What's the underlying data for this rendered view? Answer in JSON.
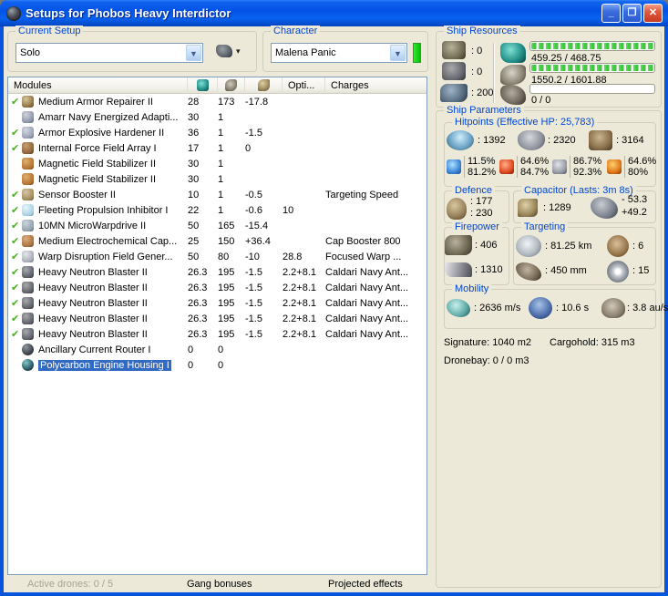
{
  "window": {
    "title": "Setups for Phobos Heavy Interdictor",
    "minimize": "_",
    "maximize": "❐",
    "close": "✕"
  },
  "colors": {
    "titlebar_blue": "#0855DD",
    "groupbox_label_blue": "#0046D5",
    "selection_blue": "#316AC5",
    "check_green": "#4CAE22",
    "resource_bar_green": "#2FC52F",
    "character_status_green": "#00D400"
  },
  "current_setup": {
    "label": "Current Setup",
    "value": "Solo",
    "ship_menu_arrow": "▾"
  },
  "character": {
    "label": "Character",
    "value": "Malena Panic"
  },
  "ship_resources": {
    "label": "Ship Resources",
    "turrets": ": 0",
    "launchers": ": 0",
    "calibration": ": 200",
    "cpu_text": "459.25 / 468.75",
    "powergrid_text": "1550.2 / 1601.88",
    "dronebandwidth_text": "0 / 0",
    "cpu_fill_pct": 100,
    "powergrid_fill_pct": 100,
    "dronebandwidth_fill_pct": 0
  },
  "modules_table": {
    "columns": {
      "modules": "Modules",
      "opti": "Opti...",
      "charges": "Charges"
    },
    "rows": [
      {
        "check": true,
        "icon": "armor-repairer",
        "name": "Medium Armor Repairer II",
        "cpu": "28",
        "pg": "173",
        "cap": "-17.8",
        "opti": "",
        "charge": ""
      },
      {
        "check": false,
        "icon": "energized-membrane",
        "name": "Amarr Navy Energized Adapti...",
        "cpu": "30",
        "pg": "1",
        "cap": "",
        "opti": "",
        "charge": ""
      },
      {
        "check": true,
        "icon": "armor-hardener",
        "name": "Armor Explosive Hardener II",
        "cpu": "36",
        "pg": "1",
        "cap": "-1.5",
        "opti": "",
        "charge": ""
      },
      {
        "check": true,
        "icon": "force-field-array",
        "name": "Internal Force Field Array I",
        "cpu": "17",
        "pg": "1",
        "cap": "0",
        "opti": "",
        "charge": ""
      },
      {
        "check": false,
        "icon": "mag-stab",
        "name": "Magnetic Field Stabilizer II",
        "cpu": "30",
        "pg": "1",
        "cap": "",
        "opti": "",
        "charge": ""
      },
      {
        "check": false,
        "icon": "mag-stab",
        "name": "Magnetic Field Stabilizer II",
        "cpu": "30",
        "pg": "1",
        "cap": "",
        "opti": "",
        "charge": ""
      },
      {
        "check": true,
        "icon": "sensor-booster",
        "name": "Sensor Booster II",
        "cpu": "10",
        "pg": "1",
        "cap": "-0.5",
        "opti": "",
        "charge": "Targeting Speed"
      },
      {
        "check": true,
        "icon": "stasis-web",
        "name": "Fleeting Propulsion Inhibitor I",
        "cpu": "22",
        "pg": "1",
        "cap": "-0.6",
        "opti": "10",
        "charge": ""
      },
      {
        "check": true,
        "icon": "mwd",
        "name": "10MN MicroWarpdrive II",
        "cpu": "50",
        "pg": "165",
        "cap": "-15.4",
        "opti": "",
        "charge": ""
      },
      {
        "check": true,
        "icon": "cap-booster",
        "name": "Medium Electrochemical Cap...",
        "cpu": "25",
        "pg": "150",
        "cap": "+36.4",
        "opti": "",
        "charge": "Cap Booster 800"
      },
      {
        "check": true,
        "icon": "warp-disruptor-field",
        "name": "Warp Disruption Field Gener...",
        "cpu": "50",
        "pg": "80",
        "cap": "-10",
        "opti": "28.8",
        "charge": "Focused Warp ..."
      },
      {
        "check": true,
        "icon": "blaster",
        "name": "Heavy Neutron Blaster II",
        "cpu": "26.3",
        "pg": "195",
        "cap": "-1.5",
        "opti": "2.2+8.1",
        "charge": "Caldari Navy Ant..."
      },
      {
        "check": true,
        "icon": "blaster",
        "name": "Heavy Neutron Blaster II",
        "cpu": "26.3",
        "pg": "195",
        "cap": "-1.5",
        "opti": "2.2+8.1",
        "charge": "Caldari Navy Ant..."
      },
      {
        "check": true,
        "icon": "blaster",
        "name": "Heavy Neutron Blaster II",
        "cpu": "26.3",
        "pg": "195",
        "cap": "-1.5",
        "opti": "2.2+8.1",
        "charge": "Caldari Navy Ant..."
      },
      {
        "check": true,
        "icon": "blaster",
        "name": "Heavy Neutron Blaster II",
        "cpu": "26.3",
        "pg": "195",
        "cap": "-1.5",
        "opti": "2.2+8.1",
        "charge": "Caldari Navy Ant..."
      },
      {
        "check": true,
        "icon": "blaster",
        "name": "Heavy Neutron Blaster II",
        "cpu": "26.3",
        "pg": "195",
        "cap": "-1.5",
        "opti": "2.2+8.1",
        "charge": "Caldari Navy Ant..."
      },
      {
        "check": false,
        "icon": "rig-router",
        "name": "Ancillary Current Router I",
        "cpu": "0",
        "pg": "0",
        "cap": "",
        "opti": "",
        "charge": ""
      },
      {
        "check": false,
        "icon": "rig-polycarbon",
        "name": "Polycarbon Engine Housing I",
        "cpu": "0",
        "pg": "0",
        "cap": "",
        "opti": "",
        "charge": "",
        "selected": true
      }
    ]
  },
  "ship_parameters": {
    "label": "Ship Parameters",
    "hitpoints": {
      "label": "Hitpoints (Effective HP: 25,783)",
      "shield": ": 1392",
      "armor": ": 2320",
      "structure": ": 3164",
      "resists": [
        {
          "type": "em",
          "top": "11.5%",
          "bottom": "81.2%"
        },
        {
          "type": "explosive",
          "top": "64.6%",
          "bottom": "84.7%"
        },
        {
          "type": "kinetic",
          "top": "86.7%",
          "bottom": "92.3%"
        },
        {
          "type": "thermal",
          "top": "64.6%",
          "bottom": "80%"
        }
      ]
    },
    "defence": {
      "label": "Defence",
      "top": ": 177",
      "bottom": ": 230"
    },
    "capacitor": {
      "label": "Capacitor (Lasts: 3m 8s)",
      "amount": ": 1289",
      "delta_top": "- 53.3",
      "delta_bottom": "+49.2"
    },
    "firepower": {
      "label": "Firepower",
      "turret_dps": ": 406",
      "volley": ": 1310"
    },
    "targeting": {
      "label": "Targeting",
      "range": ": 81.25 km",
      "max_targets": ": 6",
      "scan_res": ": 450 mm",
      "sensor_strength": ": 15"
    },
    "mobility": {
      "label": "Mobility",
      "speed": ": 2636 m/s",
      "align_time": ": 10.6 s",
      "warp_speed": ": 3.8 au/s"
    },
    "signature": "Signature: 1040 m2",
    "cargohold": "Cargohold: 315 m3",
    "dronebay": "Dronebay: 0 / 0 m3"
  },
  "footer": {
    "active_drones": "Active drones: 0 / 5",
    "gang_bonuses": "Gang bonuses",
    "projected_effects": "Projected effects"
  }
}
